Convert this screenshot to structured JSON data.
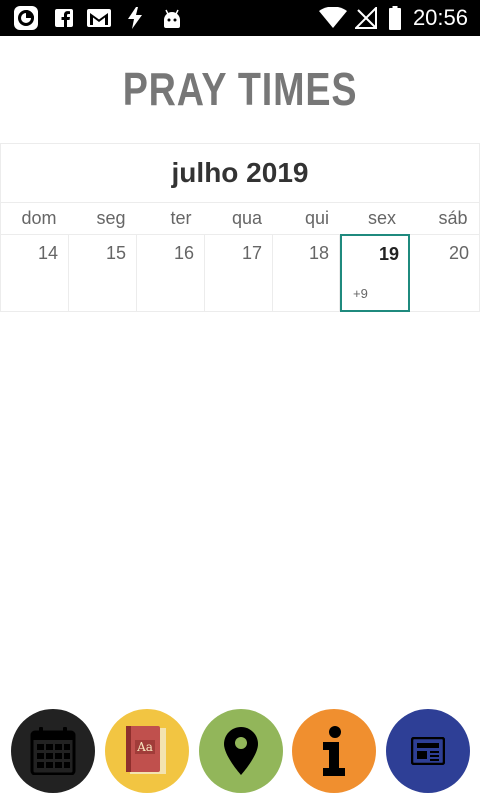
{
  "status_bar": {
    "time": "20:56",
    "icons": [
      "sync-icon",
      "facebook-icon",
      "gmail-icon",
      "flash-icon",
      "android-icon",
      "wifi-icon",
      "no-signal-icon",
      "battery-icon"
    ]
  },
  "app": {
    "title": "PRAY TIMES"
  },
  "calendar": {
    "month_label": "julho 2019",
    "weekdays": [
      "dom",
      "seg",
      "ter",
      "qua",
      "qui",
      "sex",
      "sáb"
    ],
    "days": [
      "14",
      "15",
      "16",
      "17",
      "18",
      "19",
      "20"
    ],
    "selected_day": "19",
    "selected_extra": "+9",
    "selected_color": "#1f8a7e"
  },
  "bottom_nav": {
    "items": [
      {
        "name": "calendar",
        "icon": "calendar-icon",
        "color": "#222222"
      },
      {
        "name": "dictionary",
        "icon": "book-icon",
        "color": "#f2c542"
      },
      {
        "name": "location",
        "icon": "map-pin-icon",
        "color": "#92b65a"
      },
      {
        "name": "info",
        "icon": "info-icon",
        "color": "#f08f2f"
      },
      {
        "name": "news",
        "icon": "newspaper-icon",
        "color": "#2e3f96"
      }
    ]
  }
}
